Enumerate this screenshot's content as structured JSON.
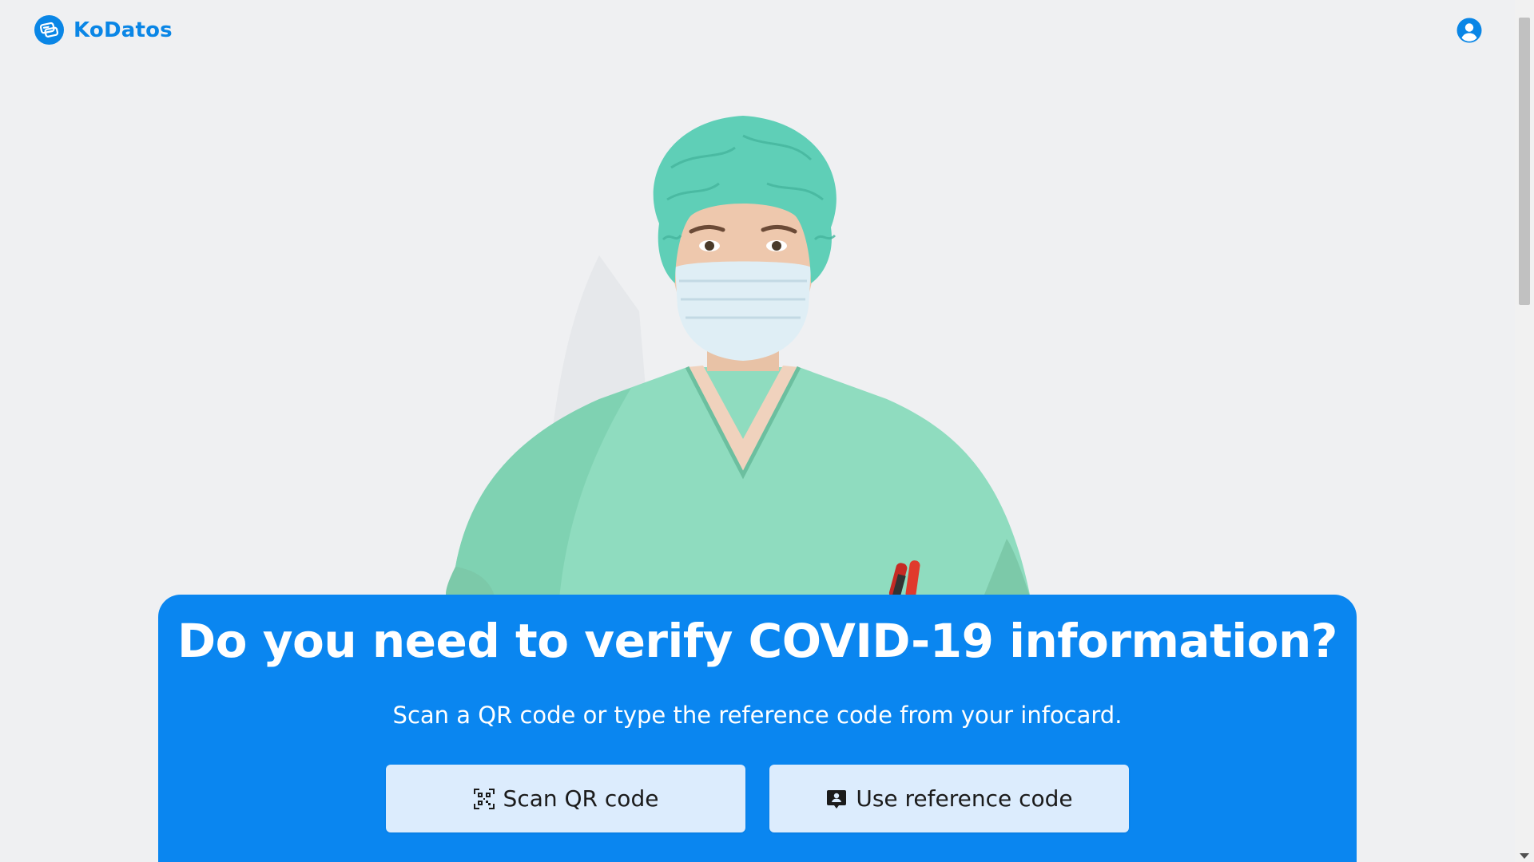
{
  "header": {
    "brand_name": "KoDatos",
    "logo_icon": "kodatos-logo-icon",
    "account_icon": "user-circle-icon"
  },
  "hero": {
    "image": "healthcare-worker-in-scrubs-and-mask"
  },
  "card": {
    "title": "Do you need to verify COVID-19 information?",
    "subtitle": "Scan a QR code or type the reference code from your infocard.",
    "buttons": {
      "scan_qr_label": "Scan QR code",
      "scan_qr_icon": "qr-code-icon",
      "reference_label": "Use reference code",
      "reference_icon": "badge-icon"
    }
  },
  "colors": {
    "brand": "#0a86e6",
    "card_background": "#0a86f0",
    "button_background": "#dcecfd",
    "page_background": "#eff0f2"
  }
}
